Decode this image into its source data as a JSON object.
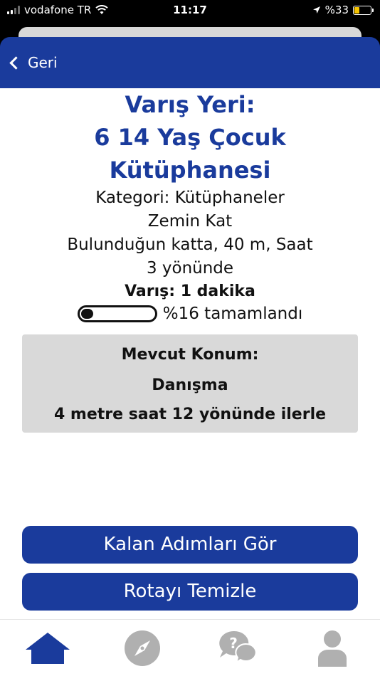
{
  "status": {
    "carrier": "vodafone TR",
    "time": "11:17",
    "battery": "%33",
    "battery_level": 0.33
  },
  "header": {
    "back_label": "Geri"
  },
  "destination": {
    "label": "Varış Yeri:",
    "name": "6 14 Yaş Çocuk Kütüphanesi",
    "category": "Kategori: Kütüphaneler",
    "floor": "Zemin Kat",
    "direction_line1": "Bulunduğun katta, 40 m, Saat",
    "direction_line2": "3 yönünde",
    "eta": "Varış: 1 dakika",
    "progress_percent": 16,
    "progress_text": "%16 tamamlandı"
  },
  "current": {
    "title": "Mevcut Konum:",
    "location": "Danışma",
    "instruction": "4 metre saat 12 yönünde ilerle"
  },
  "buttons": {
    "remaining_steps": "Kalan Adımları Gör",
    "clear_route": "Rotayı Temizle"
  },
  "tabs": [
    {
      "icon": "home-icon",
      "active": true
    },
    {
      "icon": "compass-icon",
      "active": false
    },
    {
      "icon": "help-chat-icon",
      "active": false
    },
    {
      "icon": "profile-icon",
      "active": false
    }
  ],
  "colors": {
    "brand": "#1a3b9c",
    "card": "#d9d9d9",
    "inactive": "#b0b0b0"
  }
}
